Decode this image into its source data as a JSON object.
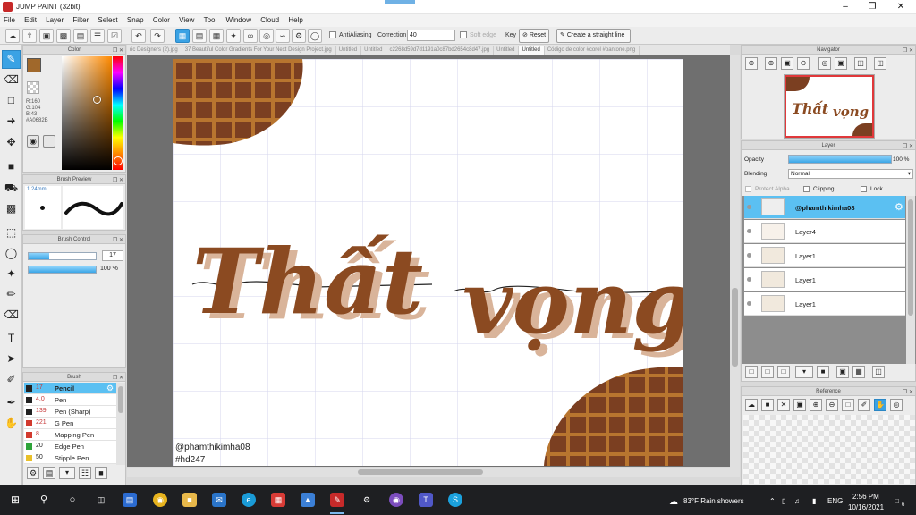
{
  "window": {
    "title": "JUMP PAINT (32bit)"
  },
  "menu": [
    "File",
    "Edit",
    "Layer",
    "Filter",
    "Select",
    "Snap",
    "Color",
    "View",
    "Tool",
    "Window",
    "Cloud",
    "Help"
  ],
  "toolbar": {
    "antialias_label": "AntiAliasing",
    "correction_label": "Correction",
    "correction_value": "40",
    "soft_edge_label": "Soft edge",
    "key_label": "Key",
    "reset_label": "Reset",
    "straight_label": "Create a straight line"
  },
  "tabs": [
    "ric Designers (2).jpg",
    "37 Beautiful Color Gradients For Your Next Design Project.jpg",
    "Untitled",
    "Untitled",
    "c2268d59d7d1191a0c87bd2654c8d47.jpg",
    "Untitled",
    "Untitled",
    "Código de color #corel #pantone.png"
  ],
  "color_panel": {
    "title": "Color",
    "r": "R:160",
    "g": "G:104",
    "b": "B:43",
    "hex": "#A0682B",
    "fg_color": "#A0682B",
    "bg_color": "#ffffff"
  },
  "brush_preview": {
    "title": "Brush Preview",
    "size_label": "1.24mm"
  },
  "brush_control": {
    "title": "Brush Control",
    "size_value": "17",
    "opacity_value": "100 %"
  },
  "brush_panel": {
    "title": "Brush",
    "items": [
      {
        "size": "17",
        "name": "Pencil",
        "color": "#222222"
      },
      {
        "size": "4.0",
        "name": "Pen",
        "color": "#222222"
      },
      {
        "size": "139",
        "name": "Pen (Sharp)",
        "color": "#222222"
      },
      {
        "size": "221",
        "name": "G Pen",
        "color": "#d23a2e"
      },
      {
        "size": "8",
        "name": "Mapping Pen",
        "color": "#d23a2e"
      },
      {
        "size": "20",
        "name": "Edge Pen",
        "color": "#2fa43a"
      },
      {
        "size": "50",
        "name": "Stipple Pen",
        "color": "#e9c02a"
      }
    ]
  },
  "navigator": {
    "title": "Navigator"
  },
  "layer_panel": {
    "title": "Layer",
    "opacity_label": "Opacity",
    "opacity_value": "100 %",
    "opacity_fraction": 1.0,
    "blending_label": "Blending",
    "blending_value": "Normal",
    "protect_alpha_label": "Protect Alpha",
    "clipping_label": "Clipping",
    "lock_label": "Lock",
    "layers": [
      {
        "name": "@phamthikimha08",
        "selected": true
      },
      {
        "name": "Layer4",
        "selected": false
      },
      {
        "name": "Layer1",
        "selected": false
      },
      {
        "name": "Layer1",
        "selected": false
      },
      {
        "name": "Layer1",
        "selected": false
      }
    ]
  },
  "reference": {
    "title": "Reference"
  },
  "canvas": {
    "headline_word1": "Thất",
    "headline_word2": "vọng",
    "credit": "@phamthikimha08",
    "hashtag": "#hd247",
    "lettering_color": "#8b4a21",
    "shadow_color": "#d9b49a",
    "waffle_color": "#7b3f21",
    "waffle_line_color": "#b8752f"
  },
  "taskbar": {
    "weather": "83°F  Rain showers",
    "lang": "ENG",
    "time": "2:56 PM",
    "date": "10/16/2021",
    "notif": "6"
  }
}
